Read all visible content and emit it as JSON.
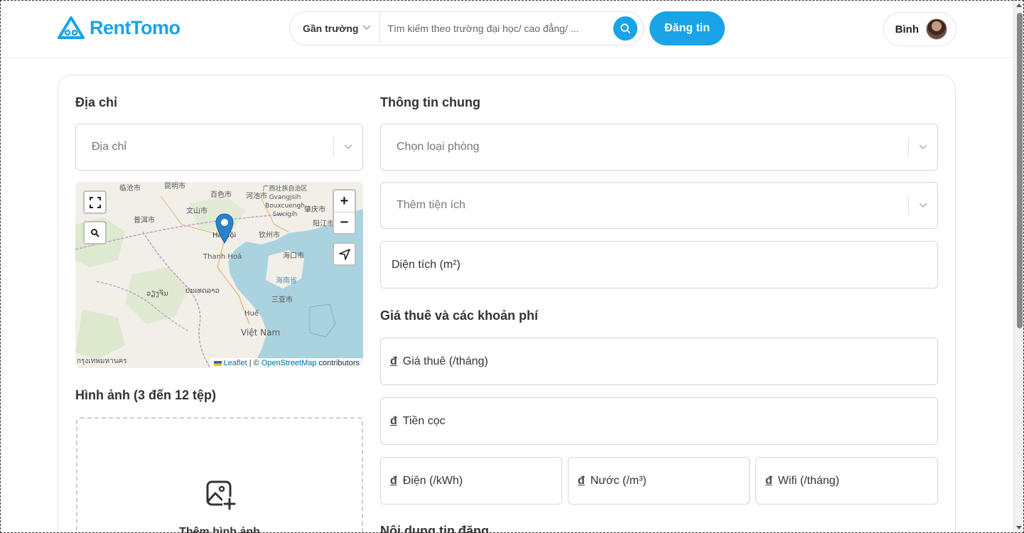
{
  "app": {
    "brand": "RentTomo",
    "accent": "#1aa3e6"
  },
  "header": {
    "search_filter": "Gần trường",
    "search_placeholder": "Tìm kiếm theo trường đại học/ cao đẳng/ ...",
    "post_button": "Đăng tin",
    "user_name": "Bình"
  },
  "address": {
    "title": "Địa chỉ",
    "select_placeholder": "Địa chỉ"
  },
  "map": {
    "labels": [
      "临沧市",
      "昆明市",
      "百色市",
      "河池市",
      "广西壮族自治区 Gvangjsih Bouxcuengh Swcigih",
      "文山市",
      "普洱市",
      "肇庆市",
      "阳江市",
      "钦州市",
      "Hà Nội",
      "海口市",
      "Thanh Hoá",
      "海南省",
      "ວຽງຈັນ",
      "ປະເທດລາວ",
      "三亚市",
      "Huế",
      "Việt Nam",
      "กรุงเทพมหานคร"
    ],
    "attribution_leaflet": "Leaflet",
    "attribution_sep": " | © ",
    "attribution_osm": "OpenStreetMap",
    "attribution_suffix": " contributors",
    "zoom_in": "+",
    "zoom_out": "−"
  },
  "images": {
    "title": "Hình ảnh (3 đến 12 tệp)",
    "add_label": "Thêm hình ảnh"
  },
  "general": {
    "title": "Thông tin chung",
    "room_type_placeholder": "Chọn loại phòng",
    "amenities_placeholder": "Thêm tiện ích",
    "area_placeholder": "Diện tích (m²)"
  },
  "fees": {
    "title": "Giá thuê và các khoản phí",
    "currency": "đ",
    "rent": "Giá thuê (/tháng)",
    "deposit": "Tiền cọc",
    "electricity": "Điện (/kWh)",
    "water": "Nước (/m³)",
    "wifi": "Wifi (/tháng)"
  },
  "content": {
    "title": "Nội dung tin đăng"
  }
}
